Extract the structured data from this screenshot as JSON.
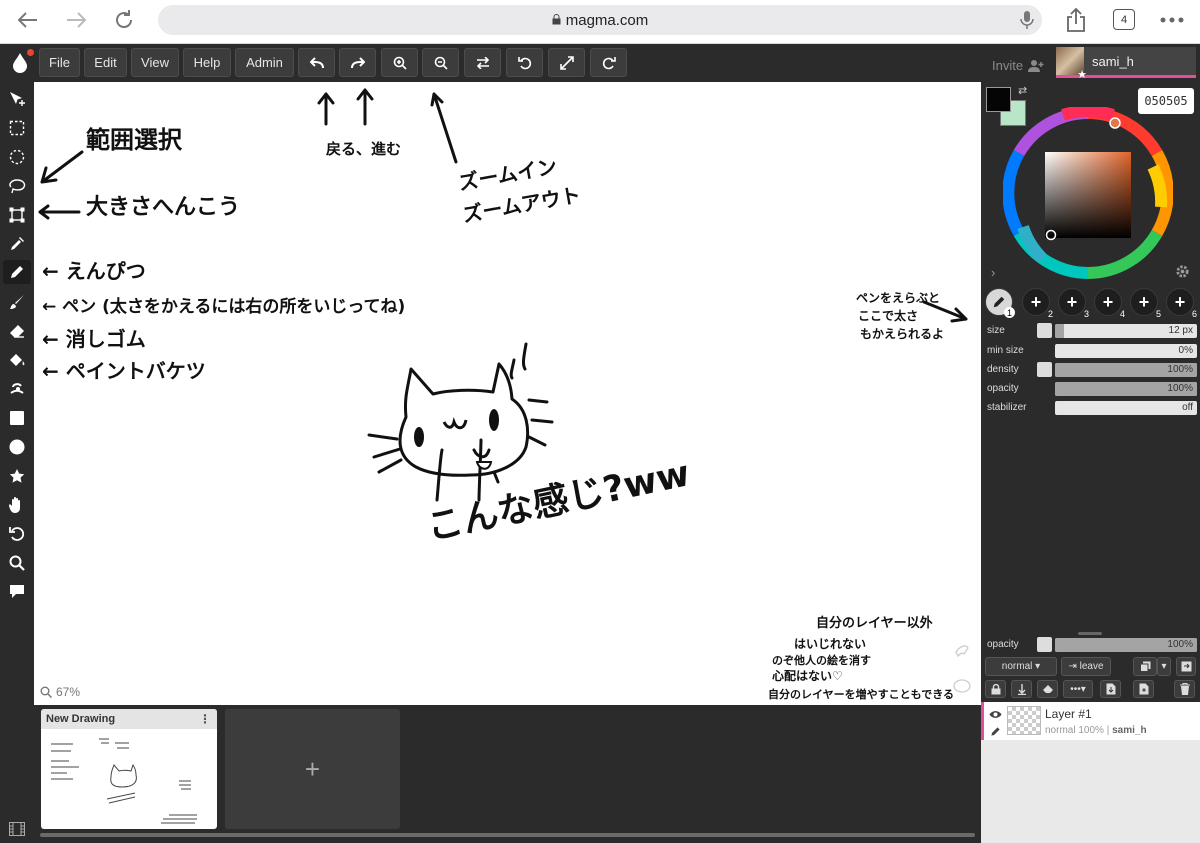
{
  "browser": {
    "url": "magma.com",
    "tab_count": "4"
  },
  "menu": {
    "file": "File",
    "edit": "Edit",
    "view": "View",
    "help": "Help",
    "admin": "Admin"
  },
  "topbar_icons": [
    "undo-icon",
    "redo-icon",
    "zoom-in-icon",
    "zoom-out-icon",
    "flip-icon",
    "rotate-icon",
    "fullscreen-icon",
    "reset-view-icon"
  ],
  "user": {
    "invite_label": "Invite",
    "name": "sami_h"
  },
  "color": {
    "hex": "050505",
    "foreground": "#050505",
    "background": "#b9e6c6",
    "hue_ring_marker": "#e0784a"
  },
  "brushes": {
    "slots": [
      "1",
      "2",
      "3",
      "4",
      "5",
      "6"
    ]
  },
  "brush_props": [
    {
      "label": "size",
      "value": "12 px",
      "level": 0.06
    },
    {
      "label": "min size",
      "value": "0%",
      "level": 0
    },
    {
      "label": "density",
      "value": "100%",
      "level": 1
    },
    {
      "label": "opacity",
      "value": "100%",
      "level": 1
    },
    {
      "label": "stabilizer",
      "value": "off",
      "level": 0
    }
  ],
  "layer_panel": {
    "opacity_label": "opacity",
    "opacity_value": "100%",
    "blend_mode": "normal",
    "leave_label": "leave"
  },
  "layers": [
    {
      "name": "Layer #1",
      "mode": "normal",
      "opacity": "100%",
      "owner": "sami_h"
    }
  ],
  "canvas": {
    "zoom": "67%",
    "notes": {
      "select": "範囲選択",
      "resize": "大きさへんこう",
      "pencil": "← えんぴつ",
      "pen": "← ペン (太さをかえるには右の所をいじってね)",
      "eraser": "← 消しゴム",
      "bucket": "← ペイントバケツ",
      "undo_redo": "戻る、進む",
      "zoom_in": "ズームイン",
      "zoom_out": "ズームアウト",
      "brush_tip_1": "ペンをえらぶと",
      "brush_tip_2": "ここで太さ",
      "brush_tip_3": "もかえられるよ",
      "layer_tip_1": "自分のレイヤー以外",
      "layer_tip_2": "はいじれない",
      "layer_tip_3": "のぞ他人の絵を消す",
      "layer_tip_4": "心配はない♡",
      "layer_tip_5": "自分のレイヤーを増やすこともできる",
      "big_text": "こんな感じ?ww"
    }
  },
  "drawings": {
    "items": [
      {
        "title": "New Drawing"
      }
    ],
    "add_label": "+"
  }
}
